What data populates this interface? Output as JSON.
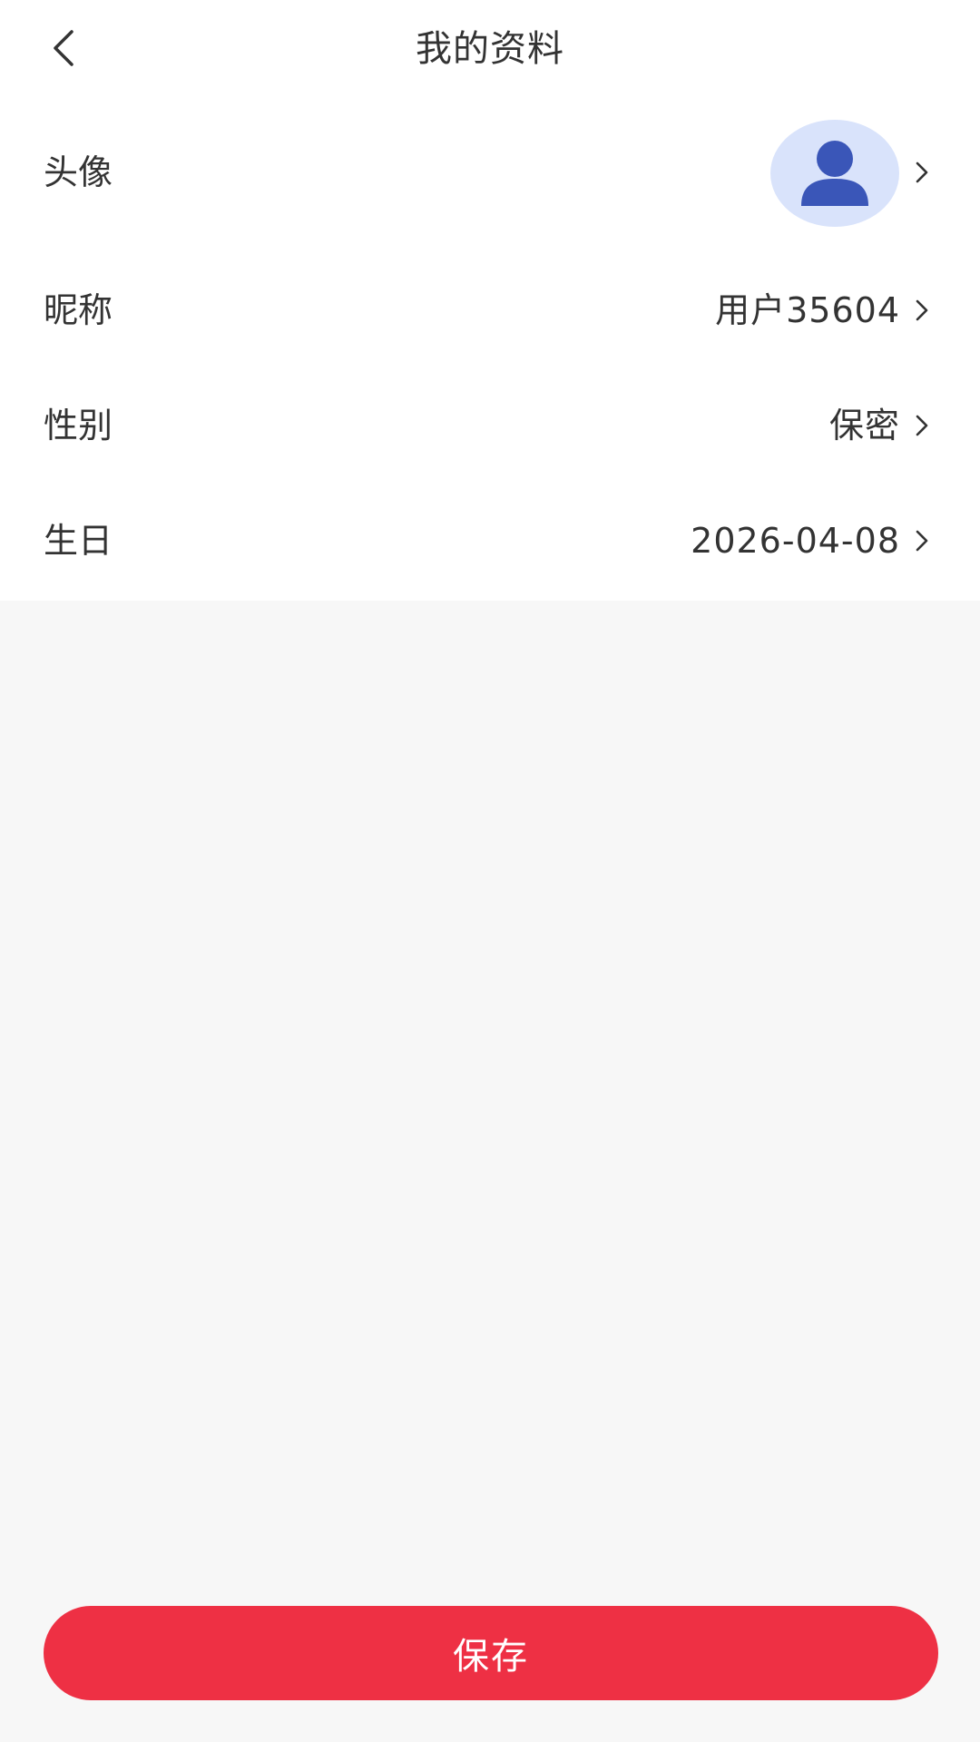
{
  "header": {
    "title": "我的资料",
    "back_icon": "chevron-left-icon"
  },
  "profile": {
    "avatar": {
      "label": "头像",
      "icon": "user-avatar-icon",
      "background_color": "#d9e3fb",
      "icon_color": "#3a56b8"
    },
    "nickname": {
      "label": "昵称",
      "value": "用户35604"
    },
    "gender": {
      "label": "性别",
      "value": "保密"
    },
    "birthday": {
      "label": "生日",
      "value": "2026-04-08"
    }
  },
  "actions": {
    "save_label": "保存",
    "save_color": "#ee3044"
  }
}
